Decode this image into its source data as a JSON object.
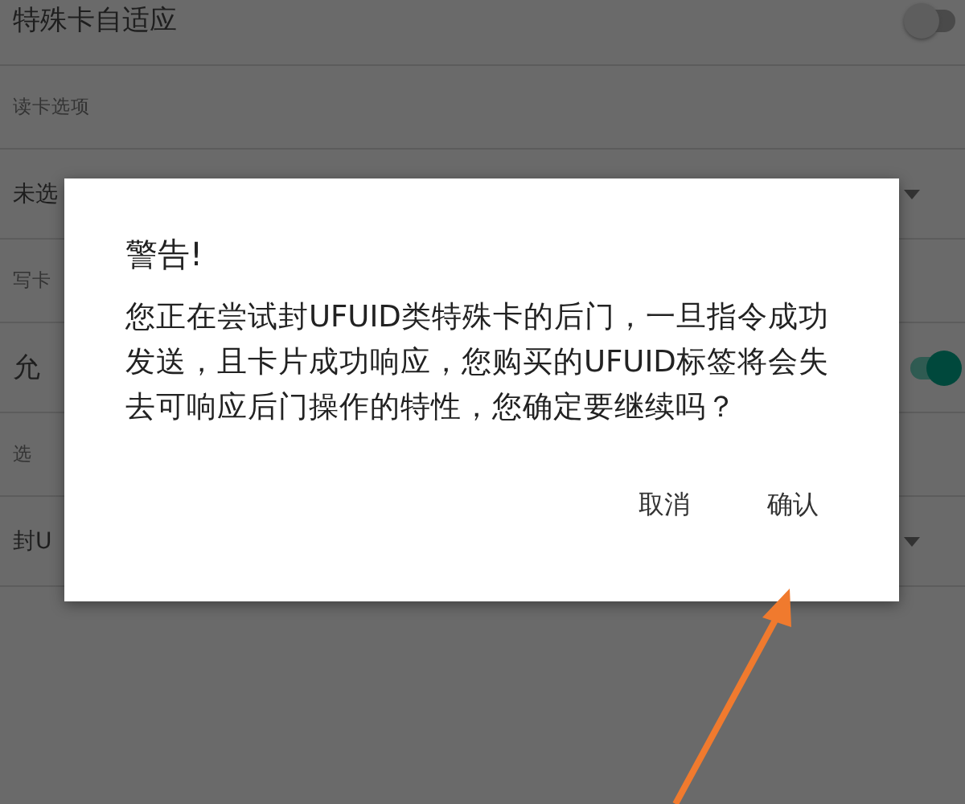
{
  "settings": [
    {
      "kind": "switch",
      "label": "特殊卡自适应",
      "on": false
    },
    {
      "kind": "header",
      "label": "读卡选项"
    },
    {
      "kind": "dropdown",
      "label": "未选"
    },
    {
      "kind": "header",
      "label": "写卡"
    },
    {
      "kind": "switch",
      "label": "允",
      "on": true
    },
    {
      "kind": "header",
      "label": "选"
    },
    {
      "kind": "dropdown",
      "label": "封U"
    }
  ],
  "dialog": {
    "title": "警告!",
    "message": "您正在尝试封UFUID类特殊卡的后门，一旦指令成功发送，且卡片成功响应，您购买的UFUID标签将会失去可响应后门操作的特性，您确定要继续吗？",
    "buttons": [
      "取消",
      "确认"
    ]
  }
}
